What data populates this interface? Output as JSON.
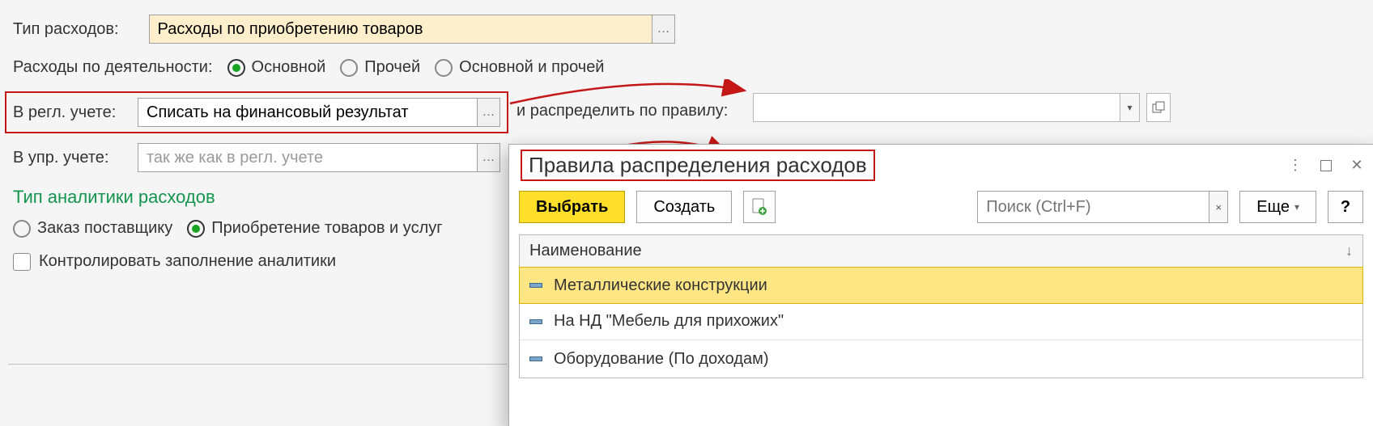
{
  "form": {
    "expense_type_label": "Тип расходов:",
    "expense_type_value": "Расходы по приобретению товаров",
    "activity_expenses_label": "Расходы по деятельности:",
    "activity_options": {
      "main": "Основной",
      "other": "Прочей",
      "both": "Основной и прочей"
    },
    "regl_label": "В регл. учете:",
    "regl_value": "Списать на финансовый результат",
    "distribute_label": "и распределить по правилу:",
    "upr_label": "В упр. учете:",
    "upr_placeholder": "так же как в регл. учете",
    "analytics_heading": "Тип аналитики расходов",
    "analytics_options": {
      "order": "Заказ поставщику",
      "purchase": "Приобретение товаров и услуг"
    },
    "control_checkbox_label": "Контролировать заполнение аналитики"
  },
  "rule_field": {
    "value": ""
  },
  "panel": {
    "title": "Правила распределения расходов",
    "buttons": {
      "select": "Выбрать",
      "create": "Создать",
      "more": "Еще"
    },
    "search_placeholder": "Поиск (Ctrl+F)",
    "column_header": "Наименование",
    "rows": [
      "Металлические конструкции",
      "На НД \"Мебель для прихожих\"",
      "Оборудование (По доходам)"
    ]
  }
}
